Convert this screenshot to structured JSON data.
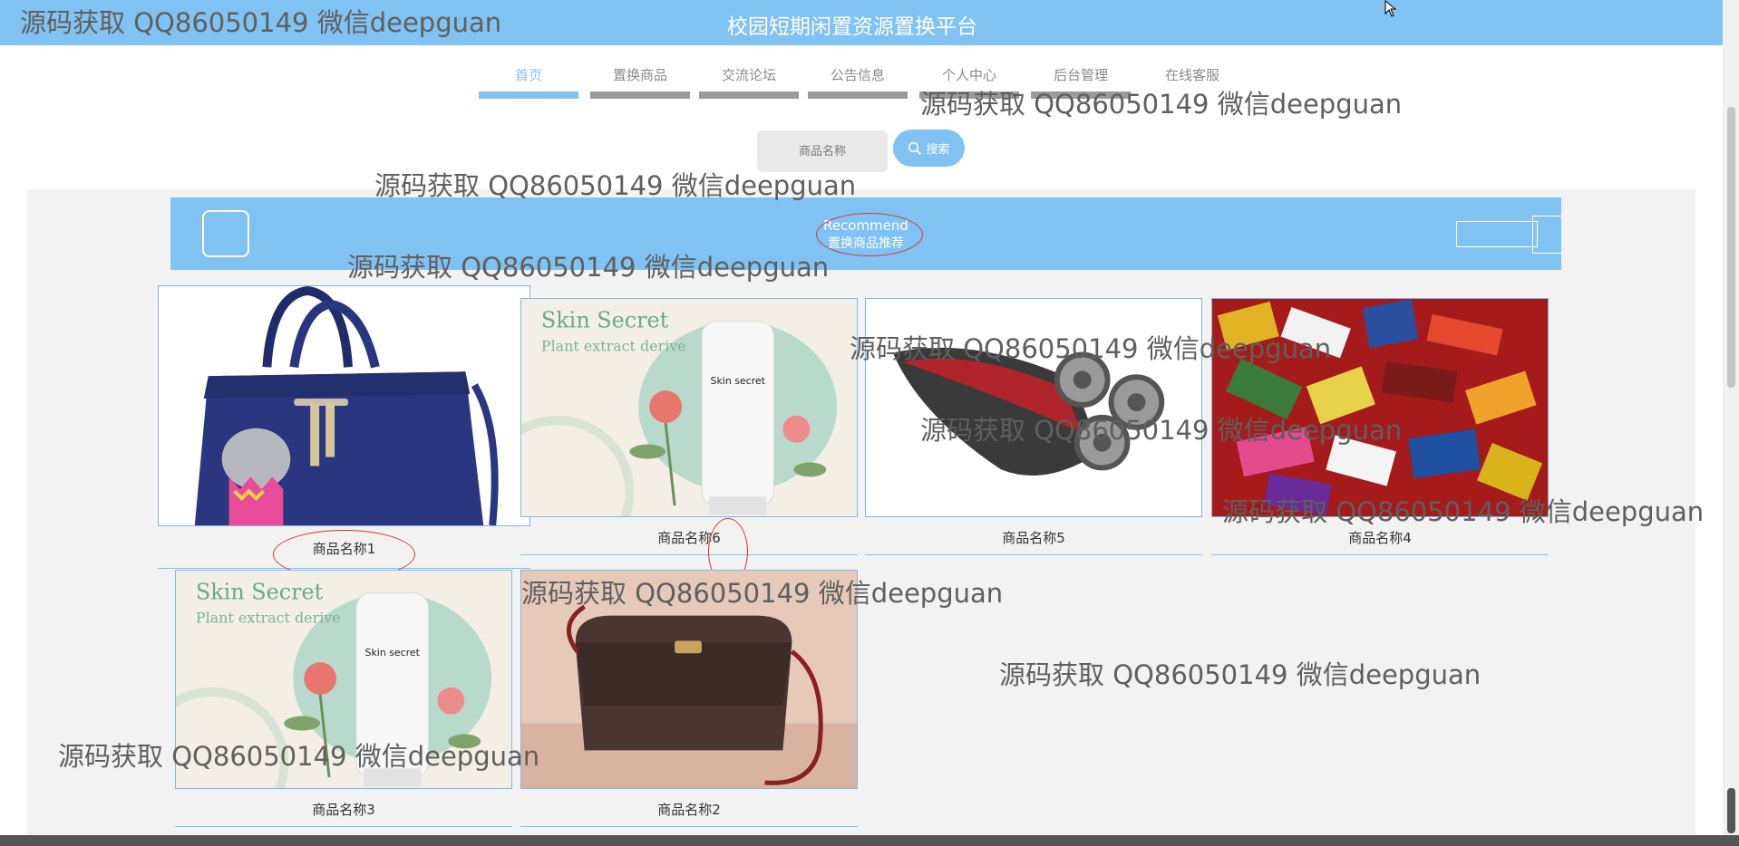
{
  "header": {
    "title": "校园短期闲置资源置换平台"
  },
  "nav": {
    "items": [
      {
        "label": "首页",
        "active": true
      },
      {
        "label": "置换商品",
        "active": false
      },
      {
        "label": "交流论坛",
        "active": false
      },
      {
        "label": "公告信息",
        "active": false
      },
      {
        "label": "个人中心",
        "active": false
      },
      {
        "label": "后台管理",
        "active": false
      },
      {
        "label": "在线客服",
        "active": false
      }
    ]
  },
  "search": {
    "placeholder": "商品名称",
    "button_label": "搜索"
  },
  "recommend": {
    "title": "Recommend",
    "subtitle": "置换商品推荐"
  },
  "products": [
    {
      "name": "商品名称1",
      "image": "handbag-blue"
    },
    {
      "name": "商品名称6",
      "image": "skin-cream"
    },
    {
      "name": "商品名称5",
      "image": "electric-shaver"
    },
    {
      "name": "商品名称4",
      "image": "candy-pile"
    },
    {
      "name": "商品名称3",
      "image": "skin-cream"
    },
    {
      "name": "商品名称2",
      "image": "shoulder-bag-brown"
    }
  ],
  "skin_text": {
    "brand": "Skin Secret",
    "tagline": "Plant extract derive",
    "tube": "Skin secret"
  },
  "watermark": "源码获取 QQ86050149 微信deepguan",
  "colors": {
    "accent": "#80c2f2",
    "annotation": "#d23a3a",
    "panel": "#f2f2f2"
  }
}
